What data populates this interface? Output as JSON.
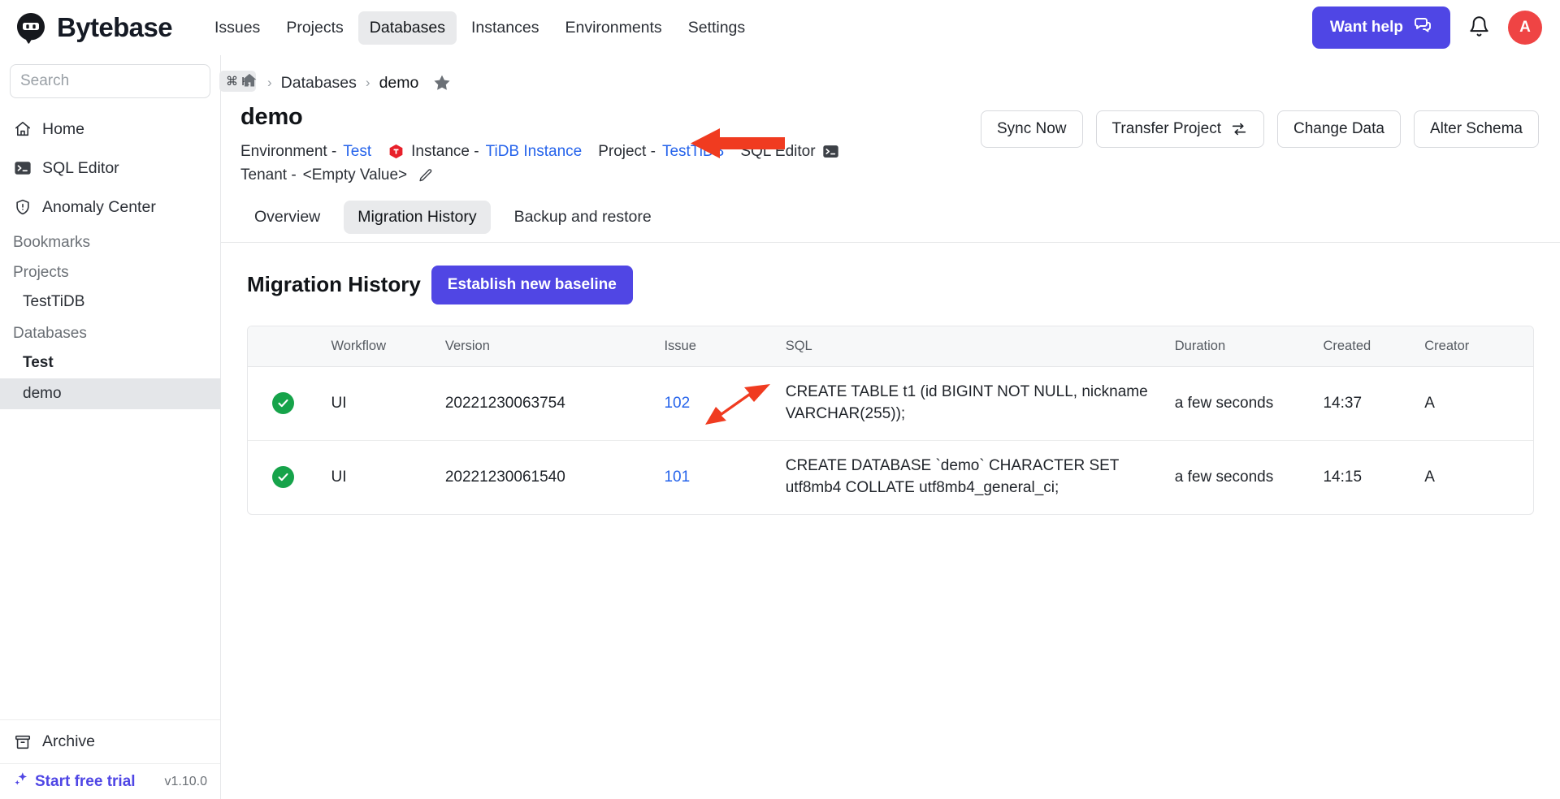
{
  "topbar": {
    "brand": "Bytebase",
    "brand_logo_icon": "bytebase-logo-icon",
    "nav": [
      {
        "label": "Issues",
        "active": false
      },
      {
        "label": "Projects",
        "active": false
      },
      {
        "label": "Databases",
        "active": true
      },
      {
        "label": "Instances",
        "active": false
      },
      {
        "label": "Environments",
        "active": false
      },
      {
        "label": "Settings",
        "active": false
      }
    ],
    "want_help_label": "Want help",
    "want_help_icon": "chat-bubble-icon",
    "notification_icon": "bell-icon",
    "avatar_initial": "A",
    "avatar_color": "#ef4444",
    "accent_color": "#4f46e5"
  },
  "sidebar": {
    "search_placeholder": "Search",
    "search_value": "",
    "search_shortcut": "⌘ K",
    "items": [
      {
        "label": "Home",
        "icon": "home-icon"
      },
      {
        "label": "SQL Editor",
        "icon": "terminal-icon"
      },
      {
        "label": "Anomaly Center",
        "icon": "shield-alert-icon"
      }
    ],
    "bookmarks_label": "Bookmarks",
    "projects_label": "Projects",
    "projects": [
      {
        "label": "TestTiDB",
        "selected": false,
        "bold": false
      }
    ],
    "databases_label": "Databases",
    "databases": [
      {
        "label": "Test",
        "selected": false,
        "bold": true
      },
      {
        "label": "demo",
        "selected": true,
        "bold": false
      }
    ],
    "archive_label": "Archive",
    "archive_icon": "archive-box-icon",
    "trial_label": "Start free trial",
    "trial_icon": "sparkles-icon",
    "version": "v1.10.0"
  },
  "breadcrumb": {
    "home_icon": "home-icon",
    "separator": "›",
    "items": [
      {
        "label": "Databases",
        "link": true
      },
      {
        "label": "demo",
        "link": false
      }
    ],
    "star_icon": "star-icon"
  },
  "page": {
    "title": "demo",
    "meta": {
      "environment_label": "Environment -",
      "environment_value": "Test",
      "instance_icon": "tidb-logo-icon",
      "instance_label": "Instance -",
      "instance_value": "TiDB Instance",
      "project_label": "Project -",
      "project_value": "TestTiDB",
      "sql_editor_label": "SQL Editor",
      "sql_editor_icon": "terminal-icon",
      "tenant_label": "Tenant -",
      "tenant_value": "<Empty Value>",
      "tenant_edit_icon": "pencil-icon"
    },
    "actions": [
      {
        "label": "Sync Now",
        "icon": null
      },
      {
        "label": "Transfer Project",
        "icon": "transfer-arrows-icon"
      },
      {
        "label": "Change Data",
        "icon": null
      },
      {
        "label": "Alter Schema",
        "icon": null
      }
    ],
    "tabs": [
      {
        "label": "Overview",
        "active": false
      },
      {
        "label": "Migration History",
        "active": true
      },
      {
        "label": "Backup and restore",
        "active": false
      }
    ]
  },
  "migration": {
    "section_title": "Migration History",
    "baseline_button": "Establish new baseline",
    "columns": [
      "",
      "Workflow",
      "Version",
      "Issue",
      "SQL",
      "Duration",
      "Created",
      "Creator"
    ],
    "rows": [
      {
        "status_icon": "check-circle-icon",
        "workflow": "UI",
        "version": "20221230063754",
        "issue": "102",
        "sql": "CREATE TABLE t1 (id BIGINT NOT NULL, nickname VARCHAR(255));",
        "duration": "a few seconds",
        "created": "14:37",
        "creator": "A"
      },
      {
        "status_icon": "check-circle-icon",
        "workflow": "UI",
        "version": "20221230061540",
        "issue": "101",
        "sql": "CREATE DATABASE `demo` CHARACTER SET utf8mb4 COLLATE utf8mb4_general_ci;",
        "duration": "a few seconds",
        "created": "14:15",
        "creator": "A"
      }
    ]
  },
  "annotations": [
    {
      "name": "arrow-pointing-to-star",
      "color": "#f03b20"
    },
    {
      "name": "arrow-pointing-to-migration-history-tab",
      "color": "#f03b20"
    }
  ]
}
